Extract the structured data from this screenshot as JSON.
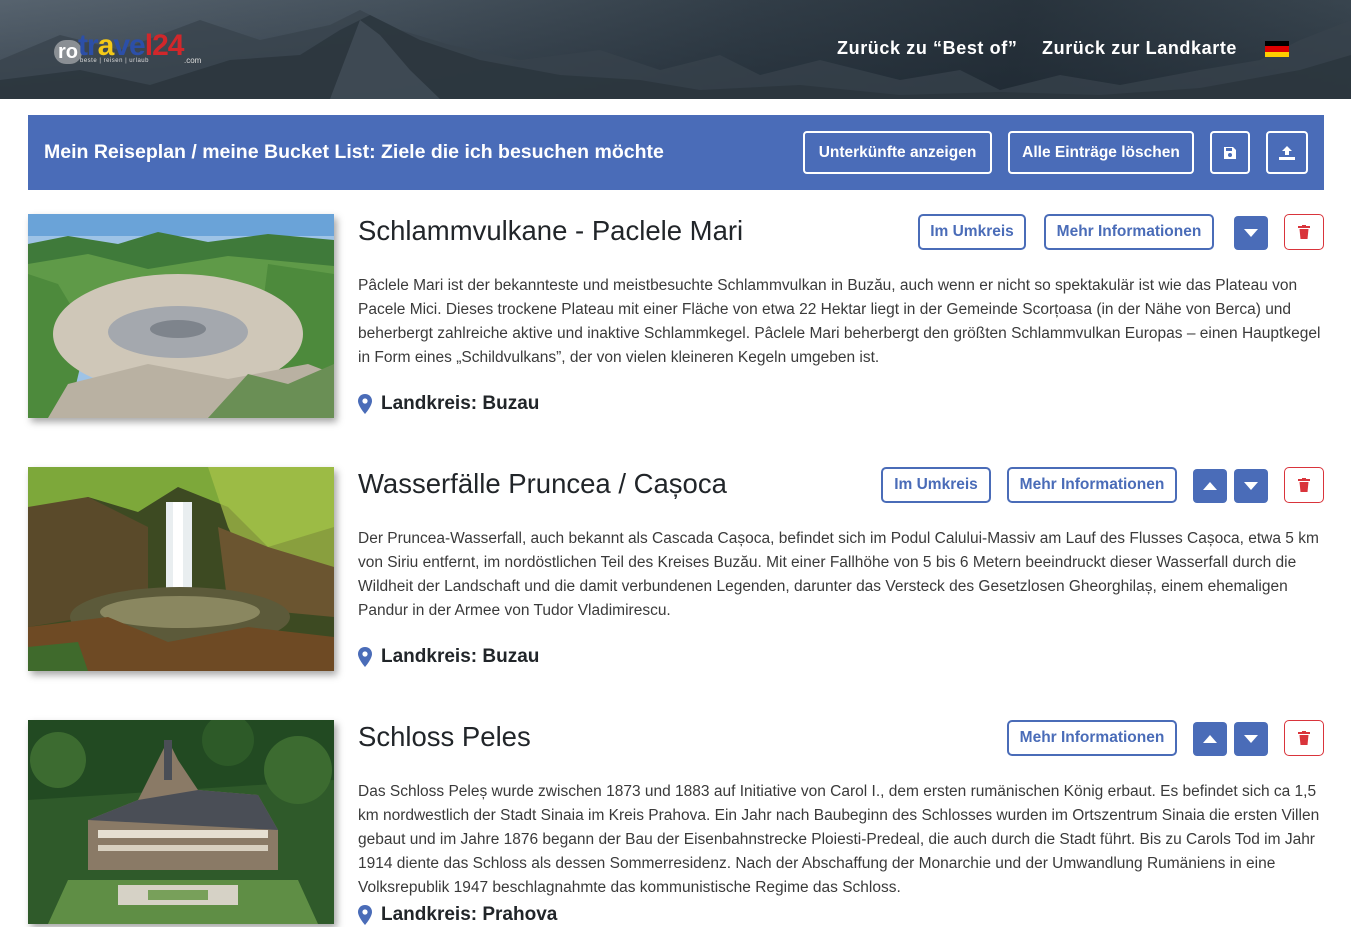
{
  "header": {
    "logo": {
      "prefix": "ro",
      "word_part1": "tr",
      "word_part2": "a",
      "word_part3": "ve",
      "word_part4": "l24",
      "tagline": "beste | reisen | urlaub",
      "suffix": ".com"
    },
    "nav": {
      "best_of": "Zurück zu “Best of”",
      "map": "Zurück zur Landkarte"
    },
    "flag": {
      "colors": [
        "#000000",
        "#dd0000",
        "#ffce00"
      ]
    }
  },
  "plan": {
    "title": "Mein Reiseplan / meine Bucket List: Ziele die ich besuchen möchte",
    "show_accommodations": "Unterkünfte anzeigen",
    "clear_all": "Alle Einträge löschen",
    "save_icon": "floppy-disk-icon",
    "upload_icon": "upload-icon"
  },
  "entries": [
    {
      "title": "Schlammvulkane - Paclele Mari",
      "nearby": "Im Umkreis",
      "more": "Mehr Informationen",
      "description": "Pâclele Mari ist der bekannteste und meistbesuchte Schlammvulkan in Buzău, auch wenn er nicht so spektakulär ist wie das Plateau von Pacele Mici. Dieses trockene Plateau mit einer Fläche von etwa 22 Hektar liegt in der Gemeinde Scorțoasa (in der Nähe von Berca) und beherbergt zahlreiche aktive und inaktive Schlammkegel. Pâclele Mari beherbergt den größten Schlammvulkan Europas – einen Hauptkegel in Form eines „Schildvulkans”, der von vielen kleineren Kegeln umgeben ist.",
      "location": "Landkreis: Buzau"
    },
    {
      "title": "Wasserfälle Pruncea / Cașoca",
      "nearby": "Im Umkreis",
      "more": "Mehr Informationen",
      "description": "Der Pruncea-Wasserfall, auch bekannt als Cascada Cașoca, befindet sich im Podul Calului-Massiv am Lauf des Flusses Cașoca, etwa 5 km von Siriu entfernt, im nordöstlichen Teil des Kreises Buzău. Mit einer Fallhöhe von 5 bis 6 Metern beeindruckt dieser Wasserfall durch die Wildheit der Landschaft und die damit verbundenen Legenden, darunter das Versteck des Gesetzlosen Gheorghilaș, einem ehemaligen Pandur in der Armee von Tudor Vladimirescu.",
      "location": "Landkreis: Buzau"
    },
    {
      "title": "Schloss Peles",
      "more": "Mehr Informationen",
      "description": "Das Schloss Peleș wurde zwischen 1873 und 1883 auf Initiative von Carol I., dem ersten rumänischen König erbaut. Es befindet sich ca 1,5 km nordwestlich der Stadt Sinaia im Kreis Prahova. Ein Jahr nach Baubeginn des Schlosses wurden im Ortszentrum Sinaia die ersten Villen gebaut und im Jahre 1876 begann der Bau der Eisenbahnstrecke Ploiesti-Predeal, die auch durch die Stadt führt. Bis zu Carols Tod im Jahr 1914 diente das Schloss als dessen Sommerresidenz. Nach der Abschaffung der Monarchie und der Umwandlung Rumäniens in eine Volksrepublik 1947 beschlagnahmte das kommunistische Regime das Schloss.",
      "location": "Landkreis: Prahova"
    }
  ],
  "colors": {
    "accent": "#4a6cb8",
    "danger": "#d9343b"
  }
}
